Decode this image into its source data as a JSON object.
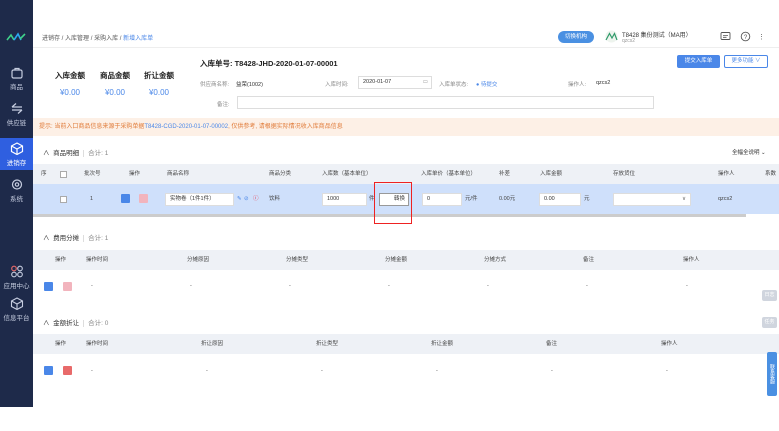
{
  "sidebar": {
    "items": [
      {
        "label": "商品",
        "icon": "bag-icon"
      },
      {
        "label": "供应链",
        "icon": "exchange-icon"
      },
      {
        "label": "进销存",
        "icon": "cube-icon",
        "active": true
      },
      {
        "label": "系统",
        "icon": "gear-icon"
      },
      {
        "label": "应用中心",
        "icon": "apps-icon"
      },
      {
        "label": "信息平台",
        "icon": "box-icon"
      }
    ],
    "accent": "#2f5fe0"
  },
  "breadcrumb": [
    "进销存",
    "入库管理",
    "采购入库",
    "新增入库单"
  ],
  "header": {
    "switch_label": "切换机构",
    "org_name": "T8428 集份测试（MA用）",
    "org_sub": "qzcs2"
  },
  "summary": [
    {
      "label": "入库金额",
      "value": "¥0.00"
    },
    {
      "label": "商品金额",
      "value": "¥0.00"
    },
    {
      "label": "折让金额",
      "value": "¥0.00"
    }
  ],
  "order": {
    "no_label": "入库单号:",
    "no_value": "T8428-JHD-2020-01-07-00001",
    "supplier_label": "供应商名称:",
    "supplier_value": "益荣(1002)",
    "date_label": "入库时间:",
    "date_value": "2020-01-07",
    "status_label": "入库单状态:",
    "status_value": "● 待提交",
    "operator_label": "操作人:",
    "operator_value": "qzcs2",
    "remark_label": "备注:"
  },
  "actions": {
    "submit": "提交入库单",
    "more": "更多功能 ∨"
  },
  "notice": {
    "before": "提示: 当前入口商品信息来源于采购单据",
    "link": "T8428-CGD-2020-01-07-00002",
    "after": ", 仅供参考, 请根据实际情况收入库商品信息"
  },
  "goods": {
    "title": "商品明细",
    "count": "合计: 1",
    "settings": "全幅全说明 ⌄",
    "columns": [
      "序",
      "批次号",
      "操作",
      "商品名称",
      "商品分类",
      "入库数（基本单位）",
      "入库单价（基本单位）",
      "补差",
      "入库金额",
      "存放货位",
      "操作人",
      "系数"
    ],
    "row": {
      "no": "1",
      "name": "实物卷（1件1件）",
      "category": "饮料",
      "qty": "1000",
      "unit": "件",
      "convert_btn": "转换",
      "price": "0",
      "price_unit": "元/件",
      "diff": "0.00元",
      "amount": "0.00",
      "amount_unit": "元",
      "operator": "qzcs2"
    }
  },
  "cost": {
    "title": "费用分摊",
    "count": "合计: 1",
    "columns": [
      "操作",
      "操作时间",
      "分摊原因",
      "分摊类型",
      "分摊金额",
      "分摊方式",
      "备注",
      "操作人"
    ],
    "row": [
      "-",
      "-",
      "-",
      "-",
      "-",
      "-",
      "-",
      "-"
    ]
  },
  "discount": {
    "title": "金额折让",
    "count": "合计: 0",
    "columns": [
      "操作",
      "操作时间",
      "折让原因",
      "折让类型",
      "折让金额",
      "备注",
      "操作人"
    ],
    "row": [
      "-",
      "-",
      "-",
      "-",
      "-",
      "-",
      "-"
    ]
  },
  "floats": {
    "a": "日志",
    "b": "任务",
    "c": "联系客服"
  }
}
